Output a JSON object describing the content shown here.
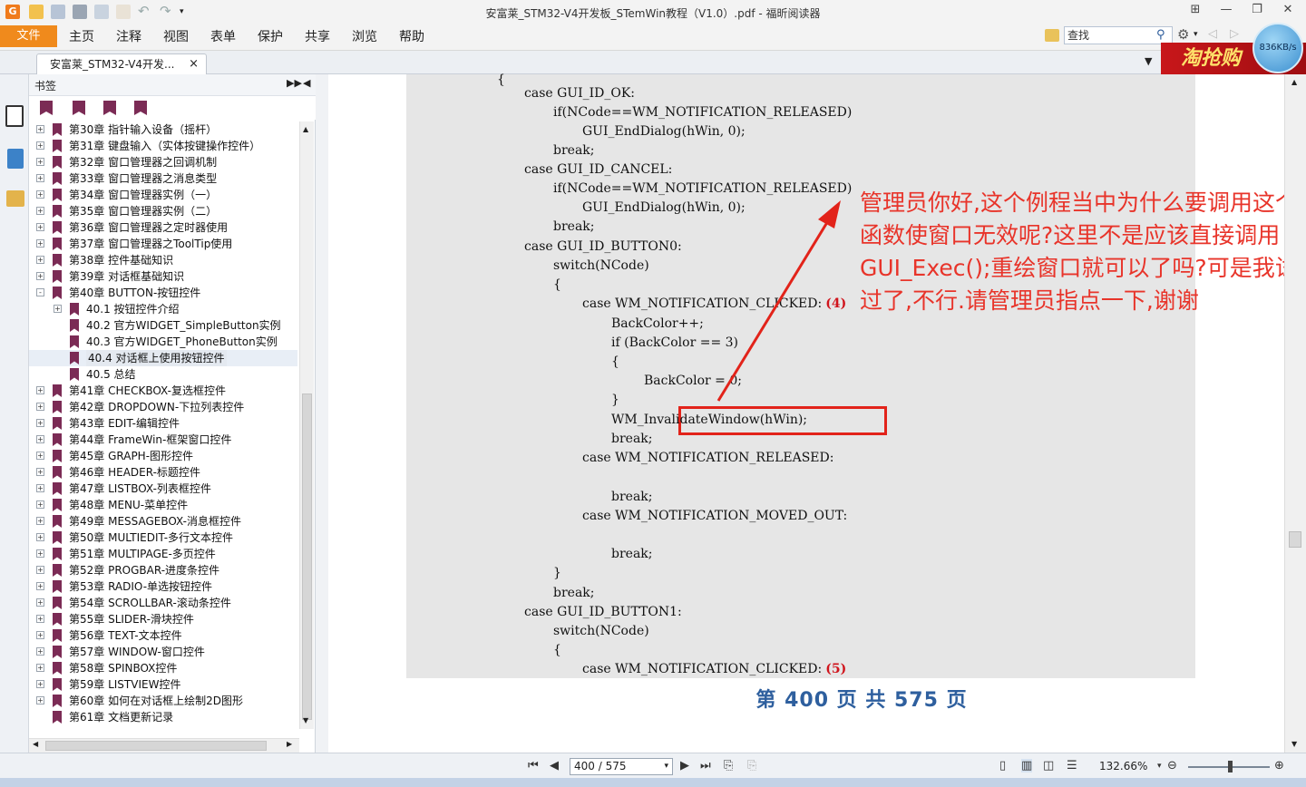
{
  "window": {
    "title": "安富莱_STM32-V4开发板_STemWin教程（V1.0）.pdf - 福昕阅读器"
  },
  "menu": {
    "file": "文件",
    "items": [
      "主页",
      "注释",
      "视图",
      "表单",
      "保护",
      "共享",
      "浏览",
      "帮助"
    ],
    "search_placeholder": "查找"
  },
  "tab": {
    "label": "安富莱_STM32-V4开发...",
    "close": "×"
  },
  "ad": {
    "text": "淘抢购",
    "speed": "836KB/s"
  },
  "sidebar": {
    "title": "书签",
    "bookmarks": [
      {
        "label": "第30章 指针输入设备（摇杆）",
        "level": 0,
        "expander": "+"
      },
      {
        "label": "第31章 键盘输入（实体按键操作控件）",
        "level": 0,
        "expander": "+"
      },
      {
        "label": "第32章 窗口管理器之回调机制",
        "level": 0,
        "expander": "+"
      },
      {
        "label": "第33章 窗口管理器之消息类型",
        "level": 0,
        "expander": "+"
      },
      {
        "label": "第34章 窗口管理器实例（一）",
        "level": 0,
        "expander": "+"
      },
      {
        "label": "第35章 窗口管理器实例（二）",
        "level": 0,
        "expander": "+"
      },
      {
        "label": "第36章 窗口管理器之定时器使用",
        "level": 0,
        "expander": "+"
      },
      {
        "label": "第37章 窗口管理器之ToolTip使用",
        "level": 0,
        "expander": "+"
      },
      {
        "label": "第38章 控件基础知识",
        "level": 0,
        "expander": "+"
      },
      {
        "label": "第39章 对话框基础知识",
        "level": 0,
        "expander": "+"
      },
      {
        "label": "第40章 BUTTON-按钮控件",
        "level": 0,
        "expander": "-"
      },
      {
        "label": "40.1 按钮控件介绍",
        "level": 1,
        "expander": "+"
      },
      {
        "label": "40.2 官方WIDGET_SimpleButton实例",
        "level": 1,
        "expander": ""
      },
      {
        "label": "40.3 官方WIDGET_PhoneButton实例",
        "level": 1,
        "expander": ""
      },
      {
        "label": "40.4 对话框上使用按钮控件",
        "level": 1,
        "expander": "",
        "selected": true
      },
      {
        "label": "40.5 总结",
        "level": 1,
        "expander": ""
      },
      {
        "label": "第41章 CHECKBOX-复选框控件",
        "level": 0,
        "expander": "+"
      },
      {
        "label": "第42章 DROPDOWN-下拉列表控件",
        "level": 0,
        "expander": "+"
      },
      {
        "label": "第43章 EDIT-编辑控件",
        "level": 0,
        "expander": "+"
      },
      {
        "label": "第44章 FrameWin-框架窗口控件",
        "level": 0,
        "expander": "+"
      },
      {
        "label": "第45章 GRAPH-图形控件",
        "level": 0,
        "expander": "+"
      },
      {
        "label": "第46章 HEADER-标题控件",
        "level": 0,
        "expander": "+"
      },
      {
        "label": "第47章 LISTBOX-列表框控件",
        "level": 0,
        "expander": "+"
      },
      {
        "label": "第48章 MENU-菜单控件",
        "level": 0,
        "expander": "+"
      },
      {
        "label": "第49章 MESSAGEBOX-消息框控件",
        "level": 0,
        "expander": "+"
      },
      {
        "label": "第50章 MULTIEDIT-多行文本控件",
        "level": 0,
        "expander": "+"
      },
      {
        "label": "第51章 MULTIPAGE-多页控件",
        "level": 0,
        "expander": "+"
      },
      {
        "label": "第52章 PROGBAR-进度条控件",
        "level": 0,
        "expander": "+"
      },
      {
        "label": "第53章 RADIO-单选按钮控件",
        "level": 0,
        "expander": "+"
      },
      {
        "label": "第54章 SCROLLBAR-滚动条控件",
        "level": 0,
        "expander": "+"
      },
      {
        "label": "第55章 SLIDER-滑块控件",
        "level": 0,
        "expander": "+"
      },
      {
        "label": "第56章 TEXT-文本控件",
        "level": 0,
        "expander": "+"
      },
      {
        "label": "第57章 WINDOW-窗口控件",
        "level": 0,
        "expander": "+"
      },
      {
        "label": "第58章 SPINBOX控件",
        "level": 0,
        "expander": "+"
      },
      {
        "label": "第59章 LISTVIEW控件",
        "level": 0,
        "expander": "+"
      },
      {
        "label": "第60章 如何在对话框上绘制2D图形",
        "level": 0,
        "expander": "+"
      },
      {
        "label": "第61章 文档更新记录",
        "level": 0,
        "expander": ""
      }
    ]
  },
  "document": {
    "code_lines": [
      {
        "text": "{",
        "indent": 0
      },
      {
        "text": "case GUI_ID_OK:",
        "indent": 1
      },
      {
        "text": "if(NCode==WM_NOTIFICATION_RELEASED)",
        "indent": 2
      },
      {
        "text": "GUI_EndDialog(hWin, 0);",
        "indent": 3
      },
      {
        "text": "break;",
        "indent": 2
      },
      {
        "text": "case GUI_ID_CANCEL:",
        "indent": 1
      },
      {
        "text": "if(NCode==WM_NOTIFICATION_RELEASED)",
        "indent": 2
      },
      {
        "text": "GUI_EndDialog(hWin, 0);",
        "indent": 3
      },
      {
        "text": "break;",
        "indent": 2
      },
      {
        "text": "case GUI_ID_BUTTON0:",
        "indent": 1
      },
      {
        "text": "switch(NCode)",
        "indent": 2
      },
      {
        "text": "{",
        "indent": 2
      },
      {
        "text": "case WM_NOTIFICATION_CLICKED:",
        "indent": 3,
        "num": "(4)"
      },
      {
        "text": "BackColor++;",
        "indent": 4
      },
      {
        "text": "if (BackColor == 3)",
        "indent": 4
      },
      {
        "text": "{",
        "indent": 4
      },
      {
        "text": "BackColor = 0;",
        "indent": 5
      },
      {
        "text": "}",
        "indent": 4
      },
      {
        "text": "WM_InvalidateWindow(hWin);",
        "indent": 4
      },
      {
        "text": "break;",
        "indent": 4
      },
      {
        "text": "case WM_NOTIFICATION_RELEASED:",
        "indent": 3
      },
      {
        "text": "",
        "indent": 0
      },
      {
        "text": "break;",
        "indent": 4
      },
      {
        "text": "case WM_NOTIFICATION_MOVED_OUT:",
        "indent": 3
      },
      {
        "text": "",
        "indent": 0
      },
      {
        "text": "break;",
        "indent": 4
      },
      {
        "text": "}",
        "indent": 2
      },
      {
        "text": "break;",
        "indent": 2
      },
      {
        "text": "case GUI_ID_BUTTON1:",
        "indent": 1
      },
      {
        "text": "switch(NCode)",
        "indent": 2
      },
      {
        "text": "{",
        "indent": 2
      },
      {
        "text": "case WM_NOTIFICATION_CLICKED:",
        "indent": 3,
        "num": "(5)"
      }
    ],
    "annotation": "管理员你好,这个例程当中为什么要调用这个函数使窗口无效呢?这里不是应该直接调用GUI_Exec();重绘窗口就可以了吗?可是我试过了,不行.请管理员指点一下,谢谢",
    "page_label": "第 400 页  共 575 页",
    "annotation_color": "#e8342a"
  },
  "status": {
    "page_box": "400 / 575",
    "zoom": "132.66%"
  }
}
